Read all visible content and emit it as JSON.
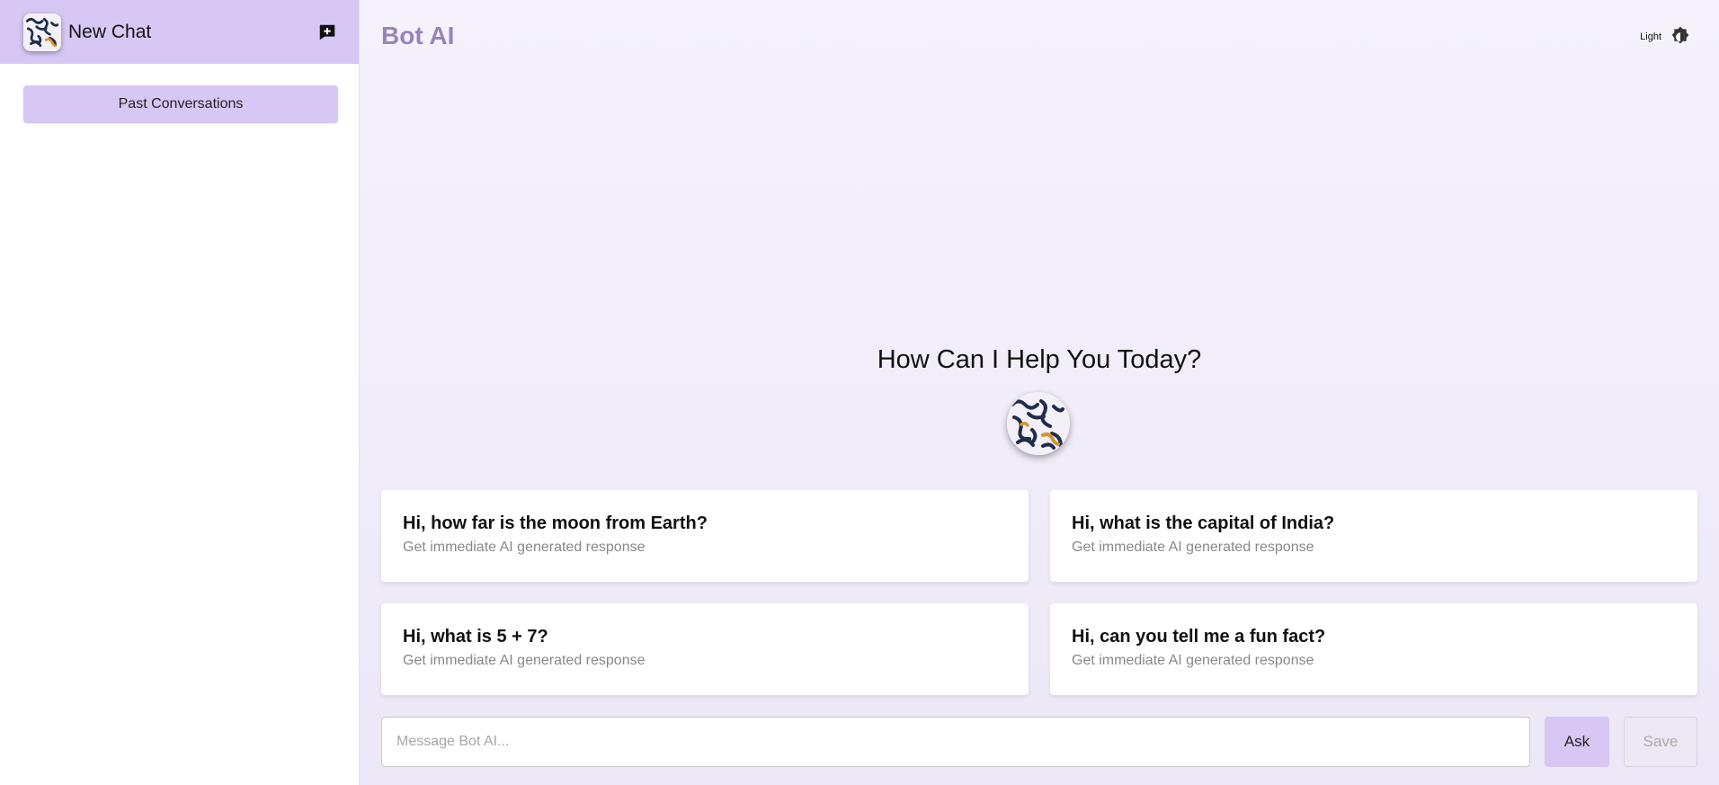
{
  "sidebar": {
    "new_chat_label": "New Chat",
    "new_chat_icon": "add-comment-icon",
    "past_conversations_label": "Past Conversations"
  },
  "header": {
    "brand": "Bot AI",
    "theme_label": "Light",
    "theme_icon": "brightness-icon"
  },
  "main": {
    "greeting": "How Can I Help You Today?",
    "cards": [
      {
        "title": "Hi, how far is the moon from Earth?",
        "subtitle": "Get immediate AI generated response"
      },
      {
        "title": "Hi, what is the capital of India?",
        "subtitle": "Get immediate AI generated response"
      },
      {
        "title": "Hi, what is 5 + 7?",
        "subtitle": "Get immediate AI generated response"
      },
      {
        "title": "Hi, can you tell me a fun fact?",
        "subtitle": "Get immediate AI generated response"
      }
    ]
  },
  "composer": {
    "placeholder": "Message Bot AI...",
    "value": "",
    "ask_label": "Ask",
    "save_label": "Save"
  },
  "colors": {
    "accent": "#d7c7f4",
    "brand": "#9785ba"
  }
}
